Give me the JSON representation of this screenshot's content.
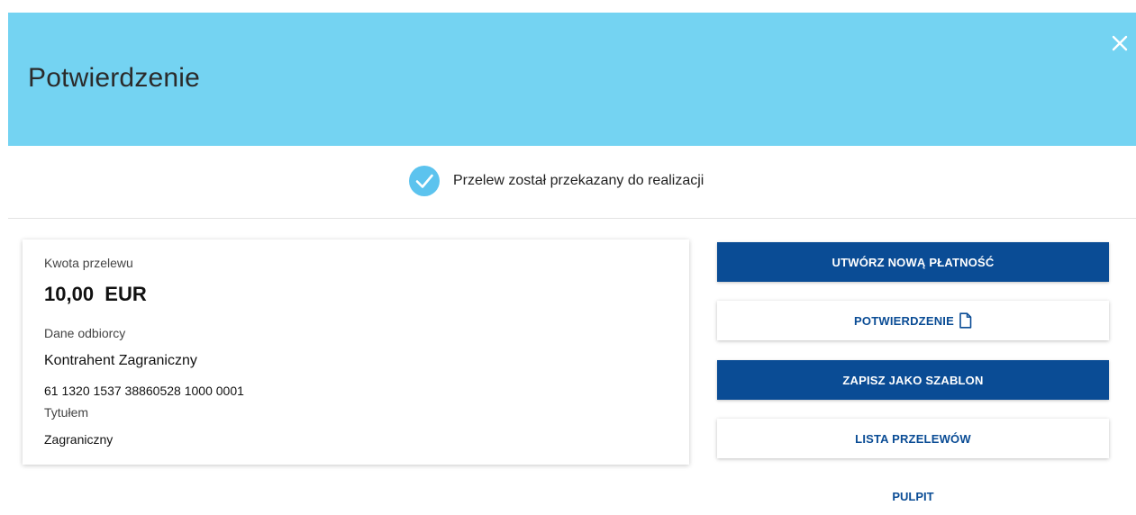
{
  "header": {
    "title": "Potwierdzenie",
    "background_color": "#74d3f2",
    "close_icon": "close-icon"
  },
  "status": {
    "message": "Przelew został przekazany do realizacji",
    "icon": "check-circle-icon",
    "icon_color": "#5cc3ee"
  },
  "details": {
    "amount_label": "Kwota przelewu",
    "amount_value": "10,00  EUR",
    "recipient_label": "Dane odbiorcy",
    "recipient_name": "Kontrahent Zagraniczny",
    "recipient_account": "61 1320 1537 38860528 1000 0001",
    "title_label": "Tytułem",
    "title_value": "Zagraniczny"
  },
  "actions": {
    "new_payment": "UTWÓRZ NOWĄ PŁATNOŚĆ",
    "confirmation": "POTWIERDZENIE",
    "confirmation_icon": "document-icon",
    "save_template": "ZAPISZ JAKO SZABLON",
    "transfer_list": "LISTA PRZELEWÓW",
    "dashboard": "PULPIT",
    "primary_color": "#0a4c95"
  }
}
